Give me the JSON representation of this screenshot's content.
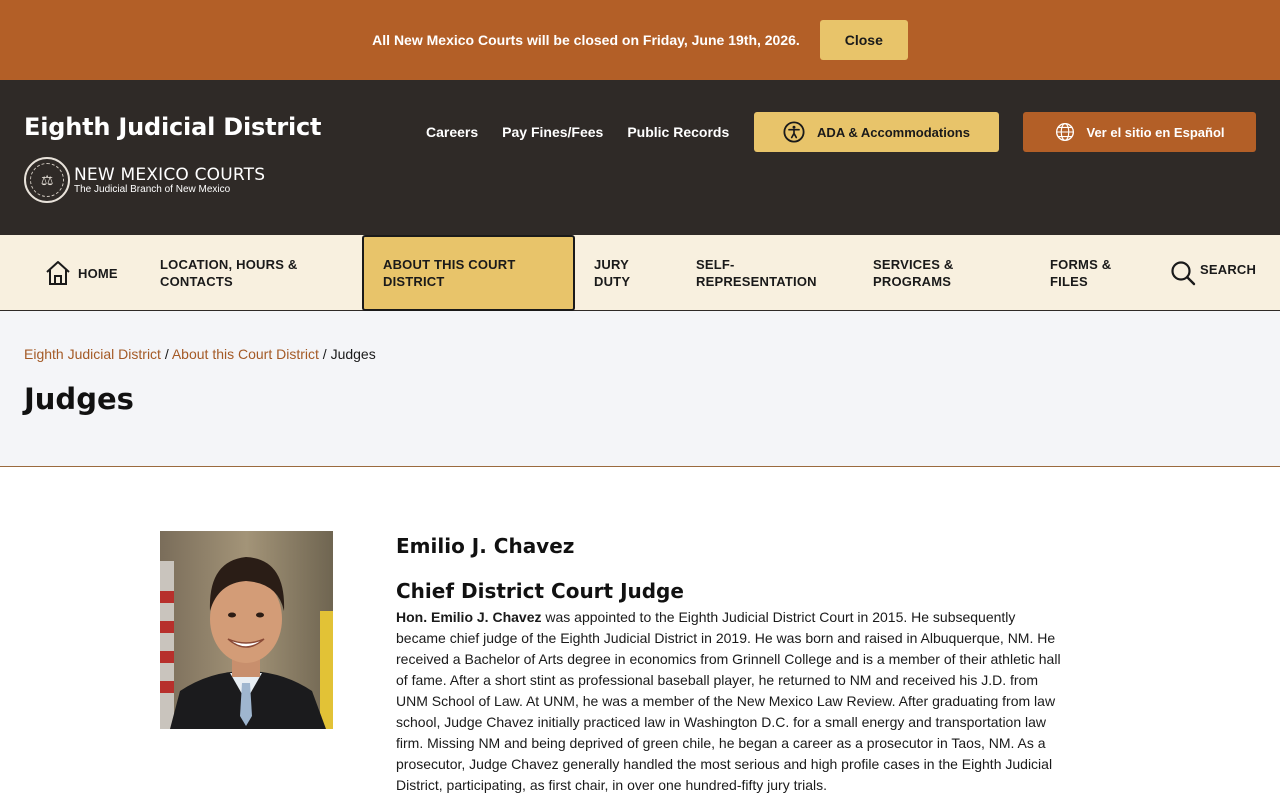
{
  "alert": {
    "message": "All New Mexico Courts will be closed on Friday, June 19th, 2026.",
    "close_label": "Close"
  },
  "header": {
    "site_title": "Eighth Judicial District",
    "logo_main": "NEW MEXICO COURTS",
    "logo_sub": "The Judicial Branch of New Mexico",
    "util_links": [
      "Careers",
      "Pay Fines/Fees",
      "Public Records"
    ],
    "ada_label": "ADA & Accommodations",
    "spanish_label": "Ver el sitio en Español"
  },
  "nav": {
    "home": "HOME",
    "location": "LOCATION, HOURS & CONTACTS",
    "about": "ABOUT THIS COURT DISTRICT",
    "jury": "JURY DUTY",
    "self_rep": "SELF-REPRESENTATION",
    "services": "SERVICES & PROGRAMS",
    "forms": "FORMS & FILES",
    "search": "SEARCH"
  },
  "breadcrumb": {
    "items": [
      "Eighth Judicial District",
      "About this Court District"
    ],
    "current": "Judges",
    "separator": " / "
  },
  "page": {
    "title": "Judges"
  },
  "judge": {
    "name": "Emilio J. Chavez",
    "role": "Chief District Court Judge",
    "bio_bold": "Hon. Emilio J. Chavez",
    "bio_text": " was appointed to the Eighth Judicial District Court in 2015. He subsequently became chief judge of the Eighth Judicial District in 2019.  He was born and raised in Albuquerque, NM.  He received a Bachelor of Arts degree in economics from Grinnell College and is a member of their athletic hall of fame. After a short stint as professional baseball player, he returned to NM and received his J.D. from UNM School of Law. At UNM, he was a member of the New Mexico Law Review.  After graduating from law school, Judge Chavez initially practiced law in Washington D.C. for a small energy and transportation law firm. Missing NM and being deprived of green chile, he began a career as a prosecutor in Taos, NM. As a prosecutor, Judge Chavez generally handled the most serious and high profile cases in the Eighth Judicial District, participating, as first chair, in over one hundred-fifty jury trials."
  },
  "colors": {
    "alert_bg": "#b35f27",
    "header_bg": "#2f2a27",
    "accent_gold": "#e8c46a",
    "nav_bg": "#f8f0df",
    "link": "#a45a26"
  },
  "icons": [
    "accessibility-icon",
    "globe-icon",
    "home-icon",
    "search-icon",
    "court-seal-icon"
  ]
}
